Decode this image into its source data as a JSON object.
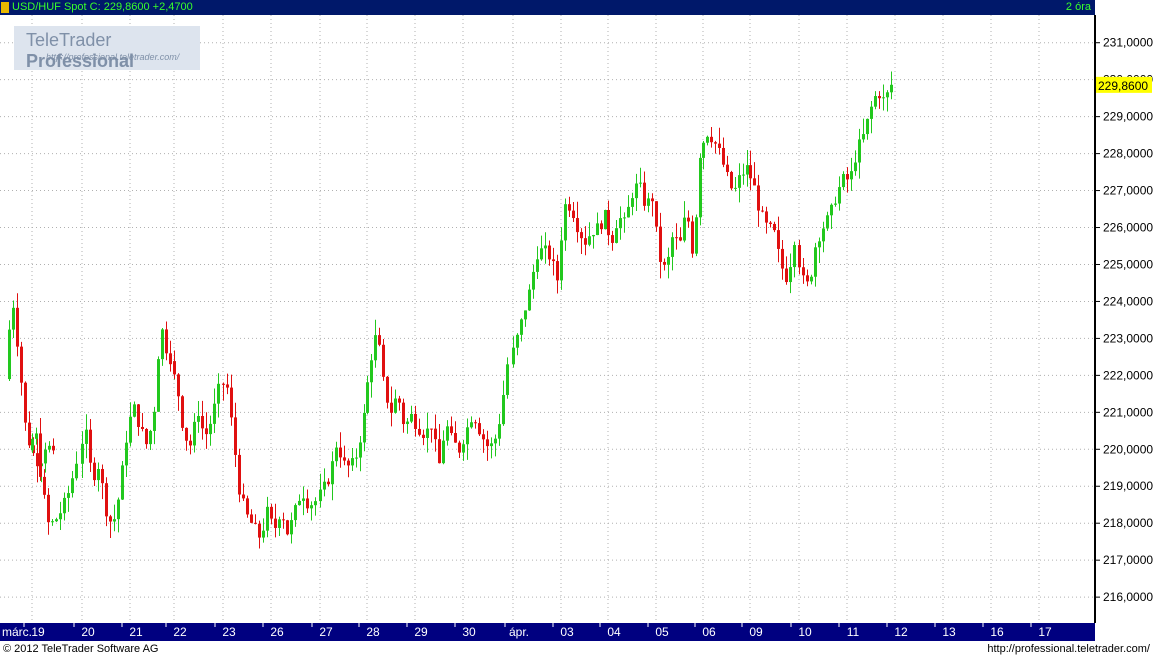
{
  "header": {
    "symbol": "USD/HUF Spot",
    "close_label": "C:",
    "close": "229,8600",
    "change": "+2,4700",
    "timeframe": "2 óra"
  },
  "logo": {
    "brand": "TeleTrader",
    "brand_bold": "Professional",
    "url": "http://professional.teletrader.com/"
  },
  "footer": {
    "copyright": "© 2012 TeleTrader Software AG",
    "url": "http://professional.teletrader.com/"
  },
  "colors": {
    "up": "#22c81e",
    "down": "#e01010",
    "axis_bg": "#000080",
    "title_bg": "#00186a",
    "title_text": "#39ff2a",
    "price_tag": "#ffff00"
  },
  "chart_data": {
    "type": "candlestick",
    "title": "USD/HUF Spot",
    "last_price_label": "229,8600",
    "last_price": 229.86,
    "ylim": [
      215.3,
      231.75
    ],
    "y_ticks": [
      {
        "v": 216,
        "label": "216,0000"
      },
      {
        "v": 217,
        "label": "217,0000"
      },
      {
        "v": 218,
        "label": "218,0000"
      },
      {
        "v": 219,
        "label": "219,0000"
      },
      {
        "v": 220,
        "label": "220,0000"
      },
      {
        "v": 221,
        "label": "221,0000"
      },
      {
        "v": 222,
        "label": "222,0000"
      },
      {
        "v": 223,
        "label": "223,0000"
      },
      {
        "v": 224,
        "label": "224,0000"
      },
      {
        "v": 225,
        "label": "225,0000"
      },
      {
        "v": 226,
        "label": "226,0000"
      },
      {
        "v": 227,
        "label": "227,0000"
      },
      {
        "v": 228,
        "label": "228,0000"
      },
      {
        "v": 229,
        "label": "229,0000"
      },
      {
        "v": 230,
        "label": "230,0000"
      },
      {
        "v": 231,
        "label": "231,0000"
      }
    ],
    "x_labels": [
      "márc.",
      "19",
      "20",
      "21",
      "22",
      "23",
      "26",
      "27",
      "28",
      "29",
      "30",
      "ápr.",
      "03",
      "04",
      "05",
      "06",
      "09",
      "10",
      "11",
      "12",
      "13",
      "16",
      "17"
    ],
    "grid": true,
    "days": [
      {
        "label": "19",
        "path": [
          221.9,
          224.2,
          222.5,
          220.5,
          219.9,
          219.6,
          220.2,
          219.8
        ]
      },
      {
        "label": "20",
        "path": [
          219.8,
          220.6,
          219.0,
          217.9,
          218.1,
          218.4,
          218.9,
          219.7
        ]
      },
      {
        "label": "21",
        "path": [
          219.7,
          220.6,
          219.2,
          219.6,
          218.4,
          217.9,
          218.8,
          220.3
        ]
      },
      {
        "label": "22",
        "path": [
          220.3,
          221.2,
          220.6,
          220.1,
          220.9,
          223.4,
          222.6,
          222.3
        ]
      },
      {
        "label": "23",
        "path": [
          222.3,
          221.7,
          220.4,
          220.1,
          221.1,
          220.3,
          220.8,
          221.6
        ]
      },
      {
        "label": "26",
        "path": [
          221.6,
          221.9,
          220.4,
          218.8,
          218.2,
          217.9,
          217.6,
          218.3
        ]
      },
      {
        "label": "27",
        "path": [
          218.3,
          217.8,
          218.4,
          217.7,
          218.3,
          218.9,
          218.5,
          218.6
        ]
      },
      {
        "label": "28",
        "path": [
          218.6,
          218.9,
          219.3,
          220.2,
          219.6,
          219.5,
          219.9,
          220.9
        ]
      },
      {
        "label": "29",
        "path": [
          220.9,
          222.4,
          223.2,
          221.7,
          221.0,
          221.5,
          220.6,
          220.9
        ]
      },
      {
        "label": "30",
        "path": [
          220.9,
          220.6,
          220.4,
          220.7,
          219.5,
          220.7,
          220.2,
          220.0
        ]
      },
      {
        "label": "ápr.",
        "path": [
          220.0,
          220.5,
          221.0,
          220.5,
          220.1,
          220.1,
          220.9,
          222.3
        ]
      },
      {
        "label": "03",
        "path": [
          222.3,
          222.9,
          223.6,
          224.3,
          225.3,
          225.4,
          225.2,
          224.6
        ]
      },
      {
        "label": "04",
        "path": [
          224.6,
          226.6,
          226.6,
          226.0,
          225.6,
          225.9,
          226.0,
          226.3
        ]
      },
      {
        "label": "05",
        "path": [
          226.3,
          225.6,
          226.3,
          226.1,
          226.9,
          227.2,
          226.6,
          226.8
        ]
      },
      {
        "label": "06",
        "path": [
          226.8,
          225.2,
          224.8,
          225.8,
          225.5,
          226.5,
          225.2,
          228.0
        ]
      },
      {
        "label": "09",
        "path": [
          228.0,
          228.6,
          228.4,
          228.0,
          227.4,
          226.9,
          227.4,
          227.6
        ]
      },
      {
        "label": "10",
        "path": [
          227.6,
          227.2,
          226.4,
          226.0,
          225.9,
          225.0,
          224.6,
          225.7
        ]
      },
      {
        "label": "11",
        "path": [
          225.7,
          224.6,
          224.4,
          225.6,
          226.0,
          226.3,
          226.9,
          227.3
        ]
      },
      {
        "label": "12",
        "path": [
          227.3,
          227.3,
          228.1,
          228.5,
          229.2,
          229.7,
          229.4,
          229.86
        ]
      }
    ]
  }
}
